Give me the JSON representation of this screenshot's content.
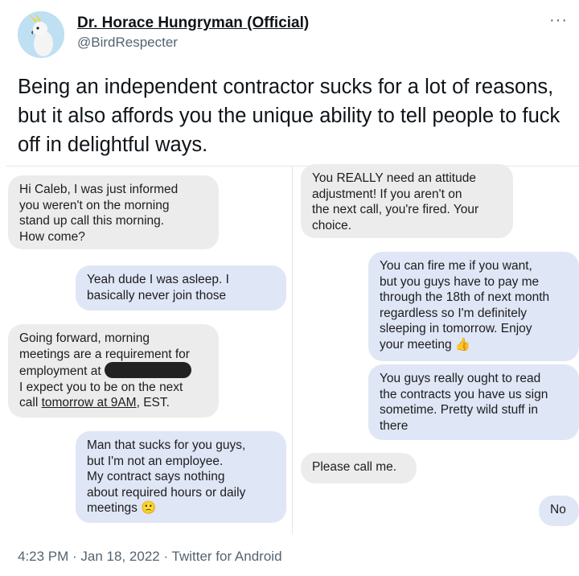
{
  "author": {
    "name": "Dr. Horace Hungryman (Official)",
    "handle": "@BirdRespecter",
    "more_label": "···"
  },
  "tweet": {
    "text": "Being an independent contractor sucks for a lot of reasons, but it also affords you the unique ability to tell people to fuck off in delightful ways."
  },
  "conversation": {
    "left": [
      {
        "from": "boss",
        "text": "Hi Caleb, I was just informed\nyou weren't on the morning\nstand up call this morning.\nHow come?"
      },
      {
        "from": "contractor",
        "text": "Yeah dude I was asleep. I\nbasically never join those"
      },
      {
        "from": "boss",
        "line1": "Going forward, morning",
        "line2": "meetings are a requirement for",
        "line3": "employment at",
        "line4": "I expect you to be on the next",
        "line5_pre": "call ",
        "line5_link": "tomorrow at 9AM",
        "line5_post": ", EST."
      },
      {
        "from": "contractor",
        "text": "Man that sucks for you guys,\nbut I'm not an employee.\nMy contract says nothing\nabout required hours or daily\nmeetings 🙁"
      }
    ],
    "right": [
      {
        "from": "boss",
        "text": "You REALLY need an attitude\nadjustment! If you aren't on\nthe next call, you're fired. Your\nchoice."
      },
      {
        "from": "contractor",
        "text": "You can fire me if you want,\nbut you guys have to pay me\nthrough the 18th of next month\nregardless so I'm definitely\nsleeping in tomorrow. Enjoy\nyour meeting 👍"
      },
      {
        "from": "contractor",
        "text": "You guys really ought to read\nthe contracts you have us sign\nsometime. Pretty wild stuff in\nthere"
      },
      {
        "from": "boss",
        "text": "Please call me."
      },
      {
        "from": "contractor",
        "text": "No"
      }
    ]
  },
  "footer": {
    "meta": "4:23 PM · Jan 18, 2022 · Twitter for Android"
  },
  "colors": {
    "incoming_bubble": "#ececec",
    "outgoing_bubble": "#dfe6f5",
    "secondary_text": "#536471"
  }
}
